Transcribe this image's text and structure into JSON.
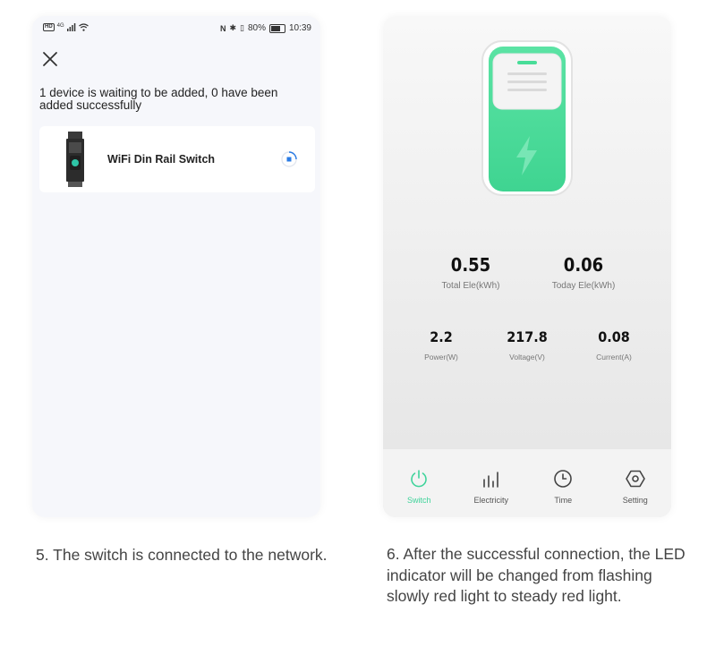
{
  "left_panel": {
    "status_bar": {
      "network": "4G",
      "battery": "80%",
      "time": "10:39"
    },
    "waiting_message": "1 device is waiting to be added, 0 have been added successfully",
    "device": {
      "name": "WiFi Din Rail Switch"
    }
  },
  "right_panel": {
    "metrics_top": [
      {
        "value": "0.55",
        "label": "Total Ele(kWh)"
      },
      {
        "value": "0.06",
        "label": "Today Ele(kWh)"
      }
    ],
    "metrics_bottom": [
      {
        "value": "2.2",
        "label": "Power(W)"
      },
      {
        "value": "217.8",
        "label": "Voltage(V)"
      },
      {
        "value": "0.08",
        "label": "Current(A)"
      }
    ],
    "tabs": [
      {
        "label": "Switch",
        "icon": "power-icon",
        "active": true
      },
      {
        "label": "Electricity",
        "icon": "bar-chart-icon",
        "active": false
      },
      {
        "label": "Time",
        "icon": "clock-icon",
        "active": false
      },
      {
        "label": "Setting",
        "icon": "hex-gear-icon",
        "active": false
      }
    ],
    "colors": {
      "accent": "#3ed39a",
      "device_green": "#48dd98"
    }
  },
  "captions": {
    "left": "5. The switch is connected to the network.",
    "right_line1": "6. After the successful connection, the LED",
    "right_line2": "indicator will be changed from flashing",
    "right_line3": "slowly red light to steady red light."
  }
}
